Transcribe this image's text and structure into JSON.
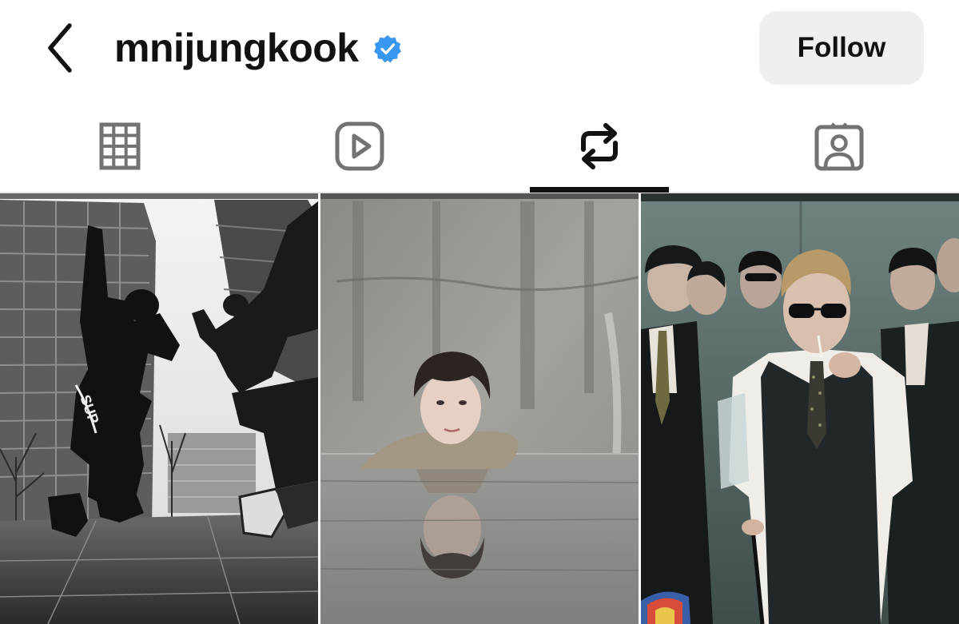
{
  "header": {
    "username": "mnijungkook",
    "follow_label": "Follow"
  },
  "icons": {
    "back": "chevron-left-icon",
    "verified": "verified-badge-icon",
    "tab_grid": "grid-icon",
    "tab_reels": "reels-play-icon",
    "tab_reposts": "repost-icon",
    "tab_tagged": "tagged-person-icon"
  },
  "tabs": {
    "active": "reposts"
  },
  "colors": {
    "verified": "#3897f0",
    "follow_bg": "#efeff1",
    "text": "#111111",
    "icon_inactive": "#737373"
  },
  "posts": [
    {
      "id": "post-1",
      "description": "black-and-white photo of two dancers jumping between high-rise buildings"
    },
    {
      "id": "post-2",
      "description": "person submerged to the neck in water in front of a concrete wall with reflection"
    },
    {
      "id": "post-3",
      "description": "group of men in dark suits in an elevator, center man in sunglasses and vest"
    }
  ]
}
